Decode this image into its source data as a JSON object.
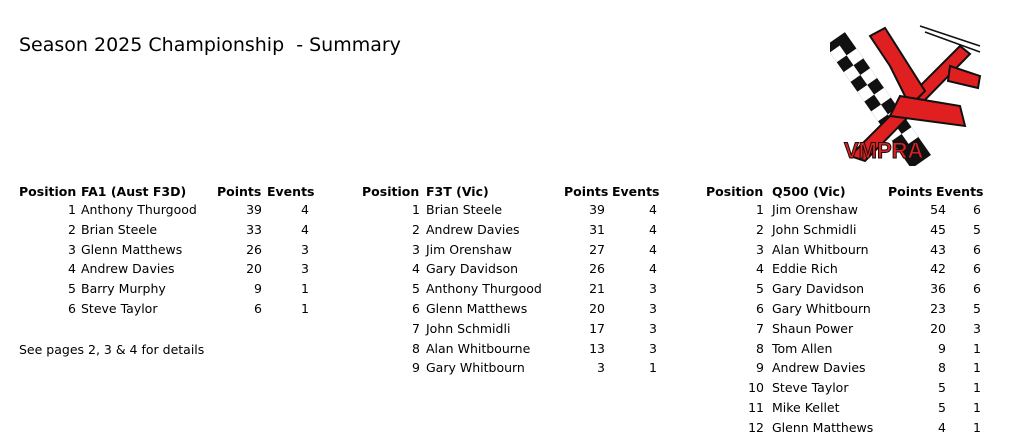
{
  "title": "Season 2025 Championship  - Summary",
  "note": "See pages 2, 3 & 4 for details",
  "logo": {
    "text": "VMPRA",
    "icon": "plane-logo-icon",
    "accent": "#e02020"
  },
  "tables": [
    {
      "headers": {
        "position": "Position",
        "class": "FA1 (Aust F3D)",
        "points": "Points",
        "events": "Events"
      },
      "rows": [
        {
          "pos": "1",
          "name": "Anthony Thurgood",
          "points": "39",
          "events": "4"
        },
        {
          "pos": "2",
          "name": "Brian Steele",
          "points": "33",
          "events": "4"
        },
        {
          "pos": "3",
          "name": "Glenn Matthews",
          "points": "26",
          "events": "3"
        },
        {
          "pos": "4",
          "name": "Andrew Davies",
          "points": "20",
          "events": "3"
        },
        {
          "pos": "5",
          "name": "Barry Murphy",
          "points": "9",
          "events": "1"
        },
        {
          "pos": "6",
          "name": "Steve Taylor",
          "points": "6",
          "events": "1"
        }
      ]
    },
    {
      "headers": {
        "position": "Position",
        "class": "F3T (Vic)",
        "points": "Points",
        "events": "Events"
      },
      "rows": [
        {
          "pos": "1",
          "name": "Brian Steele",
          "points": "39",
          "events": "4"
        },
        {
          "pos": "2",
          "name": "Andrew Davies",
          "points": "31",
          "events": "4"
        },
        {
          "pos": "3",
          "name": "Jim Orenshaw",
          "points": "27",
          "events": "4"
        },
        {
          "pos": "4",
          "name": "Gary Davidson",
          "points": "26",
          "events": "4"
        },
        {
          "pos": "5",
          "name": "Anthony Thurgood",
          "points": "21",
          "events": "3"
        },
        {
          "pos": "6",
          "name": "Glenn Matthews",
          "points": "20",
          "events": "3"
        },
        {
          "pos": "7",
          "name": "John Schmidli",
          "points": "17",
          "events": "3"
        },
        {
          "pos": "8",
          "name": "Alan Whitbourne",
          "points": "13",
          "events": "3"
        },
        {
          "pos": "9",
          "name": "Gary Whitbourn",
          "points": "3",
          "events": "1"
        }
      ]
    },
    {
      "headers": {
        "position": "Position",
        "class": "Q500 (Vic)",
        "points": "Points",
        "events": "Events"
      },
      "rows": [
        {
          "pos": "1",
          "name": "Jim Orenshaw",
          "points": "54",
          "events": "6"
        },
        {
          "pos": "2",
          "name": "John Schmidli",
          "points": "45",
          "events": "5"
        },
        {
          "pos": "3",
          "name": "Alan Whitbourn",
          "points": "43",
          "events": "6"
        },
        {
          "pos": "4",
          "name": "Eddie Rich",
          "points": "42",
          "events": "6"
        },
        {
          "pos": "5",
          "name": "Gary Davidson",
          "points": "36",
          "events": "6"
        },
        {
          "pos": "6",
          "name": "Gary Whitbourn",
          "points": "23",
          "events": "5"
        },
        {
          "pos": "7",
          "name": "Shaun Power",
          "points": "20",
          "events": "3"
        },
        {
          "pos": "8",
          "name": "Tom Allen",
          "points": "9",
          "events": "1"
        },
        {
          "pos": "9",
          "name": "Andrew Davies",
          "points": "8",
          "events": "1"
        },
        {
          "pos": "10",
          "name": "Steve Taylor",
          "points": "5",
          "events": "1"
        },
        {
          "pos": "11",
          "name": "Mike Kellet",
          "points": "5",
          "events": "1"
        },
        {
          "pos": "12",
          "name": "Glenn Matthews",
          "points": "4",
          "events": "1"
        }
      ]
    }
  ]
}
